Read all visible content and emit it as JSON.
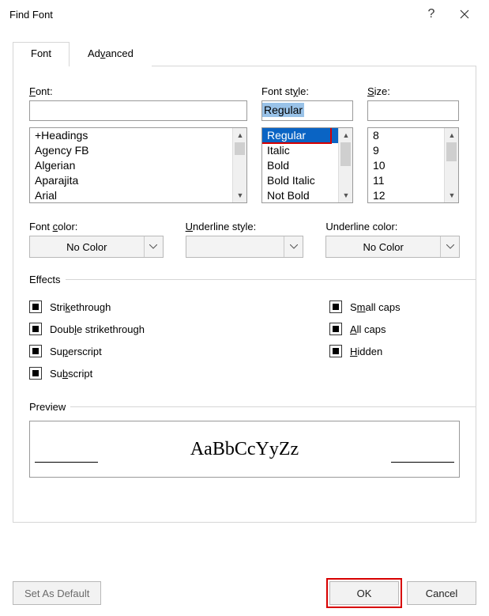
{
  "dialog": {
    "title": "Find Font",
    "help": "?",
    "close": "✕"
  },
  "tabs": {
    "font": "Font",
    "advanced_pre": "Ad",
    "advanced_u": "v",
    "advanced_post": "anced"
  },
  "labels": {
    "font_u": "F",
    "font_post": "ont:",
    "style": "Font st",
    "style_u": "y",
    "style_post": "le:",
    "size_u": "S",
    "size_post": "ize:",
    "font_color_pre": "Font ",
    "font_color_u": "c",
    "font_color_post": "olor:",
    "underline_style_u": "U",
    "underline_style_post": "nderline style:",
    "underline_color": "Underline color:",
    "effects": "Effects",
    "preview": "Preview"
  },
  "inputs": {
    "font_value": "",
    "style_value": "Regular",
    "size_value": ""
  },
  "font_list": [
    "+Headings",
    "Agency FB",
    "Algerian",
    "Aparajita",
    "Arial"
  ],
  "style_list": [
    "Regular",
    "Italic",
    "Bold",
    "Bold Italic",
    "Not Bold"
  ],
  "style_selected_index": 0,
  "size_list": [
    "8",
    "9",
    "10",
    "11",
    "12"
  ],
  "combos": {
    "font_color": "No Color",
    "underline_style": "",
    "underline_color": "No Color"
  },
  "effects": {
    "strike_pre": "Stri",
    "strike_u": "k",
    "strike_post": "ethrough",
    "dblstrike_pre": "Doub",
    "dblstrike_u": "l",
    "dblstrike_post": "e strikethrough",
    "super_pre": "Su",
    "super_u": "p",
    "super_post": "erscript",
    "sub_pre": "Su",
    "sub_u": "b",
    "sub_post": "script",
    "small_pre": "S",
    "small_u": "m",
    "small_post": "all caps",
    "all_u": "A",
    "all_post": "ll caps",
    "hidden_u": "H",
    "hidden_post": "idden"
  },
  "preview_text": "AaBbCcYyZz",
  "buttons": {
    "set_default": "Set As Default",
    "ok": "OK",
    "cancel": "Cancel"
  }
}
